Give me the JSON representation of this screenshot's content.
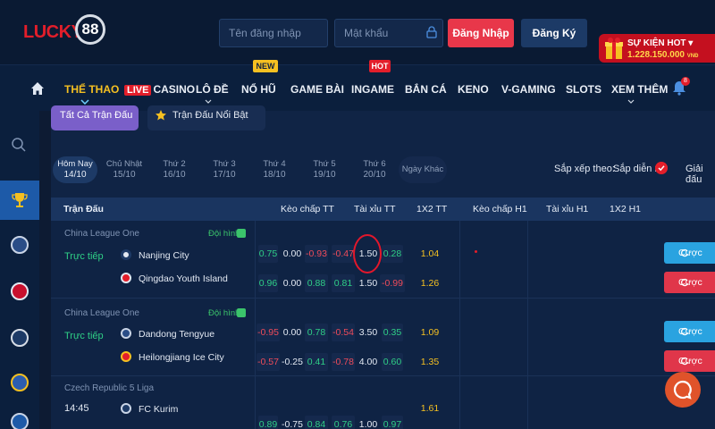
{
  "header": {
    "logo_text": "LUCKY",
    "logo_number": "88",
    "username_placeholder": "Tên đăng nhập",
    "password_placeholder": "Mật khẩu",
    "login_label": "Đăng Nhập",
    "register_label": "Đăng Ký",
    "event_title": "SỰ KIỆN HOT ▾",
    "event_amount": "1.228.150.000",
    "event_currency": "VNĐ"
  },
  "nav": {
    "items": [
      {
        "label": "THỂ THAO",
        "active": true
      },
      {
        "label": "CASINO",
        "badge": "LIVE"
      },
      {
        "label": "LÔ ĐỀ",
        "dropdown": true
      },
      {
        "label": "NỔ HŨ",
        "tag": "NEW"
      },
      {
        "label": "GAME BÀI"
      },
      {
        "label": "INGAME",
        "tag": "HOT"
      },
      {
        "label": "BẮN CÁ"
      },
      {
        "label": "KENO"
      },
      {
        "label": "V-GAMING"
      },
      {
        "label": "SLOTS"
      },
      {
        "label": "XEM THÊM",
        "dropdown": true
      }
    ],
    "bell_count": "8"
  },
  "filters": {
    "all_matches": "Tất Cả Trận Đấu",
    "featured": "Trận Đấu Nổi Bật"
  },
  "days": [
    {
      "day": "Hôm Nay",
      "date": "14/10",
      "active": true
    },
    {
      "day": "Chủ Nhật",
      "date": "15/10"
    },
    {
      "day": "Thứ 2",
      "date": "16/10"
    },
    {
      "day": "Thứ 3",
      "date": "17/10"
    },
    {
      "day": "Thứ 4",
      "date": "18/10"
    },
    {
      "day": "Thứ 5",
      "date": "19/10"
    },
    {
      "day": "Thứ 6",
      "date": "20/10"
    },
    {
      "day": "Ngày Khác",
      "date": ""
    }
  ],
  "sort": {
    "label": "Sắp xếp theo:",
    "option1": "Sắp diễn ra",
    "option2": "Giải đấu"
  },
  "table_headers": [
    "Trận Đấu",
    "Kèo chấp TT",
    "Tài xỉu TT",
    "1X2 TT",
    "Kèo chấp H1",
    "Tài xỉu H1",
    "1X2 H1"
  ],
  "lineup_label": "Đội hình",
  "bet_label": "Cược",
  "matches": [
    {
      "league": "China League One",
      "status": "Trực tiếp",
      "home": "Nanjing City",
      "away": "Qingdao Youth Island",
      "row1": [
        "0.75",
        "0.00",
        "-0.93",
        "-0.47",
        "1.50",
        "0.28",
        "1.04"
      ],
      "row2": [
        "0.96",
        "0.00",
        "0.88",
        "0.81",
        "1.50",
        "-0.99",
        "1.26"
      ]
    },
    {
      "league": "China League One",
      "status": "Trực tiếp",
      "home": "Dandong Tengyue",
      "away": "Heilongjiang Ice City",
      "row1": [
        "-0.95",
        "0.00",
        "0.78",
        "-0.54",
        "3.50",
        "0.35",
        "1.09"
      ],
      "row2": [
        "-0.57",
        "-0.25",
        "0.41",
        "-0.78",
        "4.00",
        "0.60",
        "1.35"
      ]
    },
    {
      "league": "Czech Republic 5 Liga",
      "status": "14:45",
      "home": "FC Kurim",
      "away": "",
      "row1": [
        "",
        "",
        "",
        "",
        "",
        "",
        "1.61"
      ],
      "row2": [
        "0.89",
        "-0.75",
        "0.84",
        "0.76",
        "1.00",
        "0.97",
        ""
      ]
    }
  ]
}
